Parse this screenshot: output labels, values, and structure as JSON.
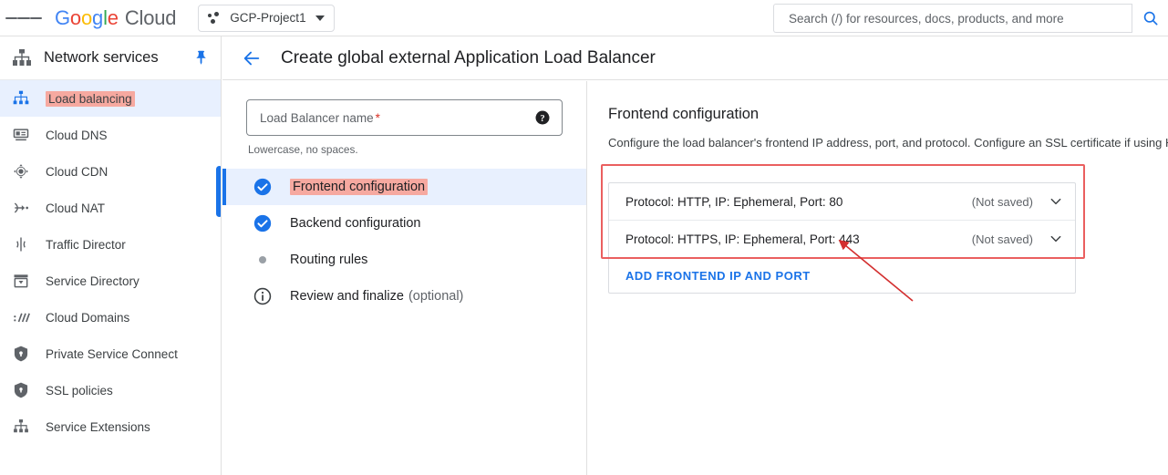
{
  "topbar": {
    "menu_icon": "hamburger-menu-icon",
    "brand": {
      "g": "G",
      "o1": "o",
      "o2": "o",
      "g2": "g",
      "l": "l",
      "e": "e",
      "cloud": "Cloud"
    },
    "project": {
      "name": "GCP-Project1",
      "icon": "project-dots-icon",
      "caret": "chevron-down-icon"
    },
    "search": {
      "placeholder": "Search (/) for resources, docs, products, and more",
      "value": "",
      "button_icon": "search-icon"
    }
  },
  "sidebar": {
    "title": "Network services",
    "header_icon": "network-services-icon",
    "pin_icon": "pin-icon",
    "items": [
      {
        "label": "Load balancing",
        "icon": "load-balancing-icon",
        "active": true,
        "highlighted": true
      },
      {
        "label": "Cloud DNS",
        "icon": "cloud-dns-icon",
        "active": false,
        "highlighted": false
      },
      {
        "label": "Cloud CDN",
        "icon": "cloud-cdn-icon",
        "active": false,
        "highlighted": false
      },
      {
        "label": "Cloud NAT",
        "icon": "cloud-nat-icon",
        "active": false,
        "highlighted": false
      },
      {
        "label": "Traffic Director",
        "icon": "traffic-director-icon",
        "active": false,
        "highlighted": false
      },
      {
        "label": "Service Directory",
        "icon": "service-directory-icon",
        "active": false,
        "highlighted": false
      },
      {
        "label": "Cloud Domains",
        "icon": "cloud-domains-icon",
        "active": false,
        "highlighted": false
      },
      {
        "label": "Private Service Connect",
        "icon": "private-service-connect-icon",
        "active": false,
        "highlighted": false
      },
      {
        "label": "SSL policies",
        "icon": "ssl-policies-icon",
        "active": false,
        "highlighted": false
      },
      {
        "label": "Service Extensions",
        "icon": "service-extensions-icon",
        "active": false,
        "highlighted": false
      }
    ]
  },
  "page": {
    "back_icon": "back-arrow-icon",
    "title": "Create global external Application Load Balancer"
  },
  "wizard": {
    "name_field": {
      "placeholder": "Load Balancer name",
      "required_marker": "*",
      "value": "",
      "help_icon": "help-icon"
    },
    "hint": "Lowercase, no spaces.",
    "steps": [
      {
        "label": "Frontend configuration",
        "status": "complete",
        "icon": "check-circle-icon",
        "active": true,
        "highlighted": true,
        "optional": ""
      },
      {
        "label": "Backend configuration",
        "status": "complete",
        "icon": "check-circle-icon",
        "active": false,
        "highlighted": false,
        "optional": ""
      },
      {
        "label": "Routing rules",
        "status": "pending",
        "icon": "dot-icon",
        "active": false,
        "highlighted": false,
        "optional": ""
      },
      {
        "label": "Review and finalize",
        "status": "info",
        "icon": "info-circle-icon",
        "active": false,
        "highlighted": false,
        "optional": "(optional)"
      }
    ]
  },
  "frontend": {
    "heading": "Frontend configuration",
    "description": "Configure the load balancer's frontend IP address, port, and protocol. Configure an SSL certificate if using H",
    "rules": [
      {
        "text": "Protocol: HTTP, IP: Ephemeral, Port: 80",
        "state": "(Not saved)",
        "chevron": "chevron-down-icon"
      },
      {
        "text": "Protocol: HTTPS, IP: Ephemeral, Port: 443",
        "state": "(Not saved)",
        "chevron": "chevron-down-icon"
      }
    ],
    "add_link": "ADD FRONTEND IP AND PORT"
  },
  "annotation": {
    "highlight_color": "#ea5f5f",
    "text_highlight_color": "#f6a9a0",
    "arrow_color": "#d32f2f",
    "arrow_target": "frontend-rule-https-row"
  }
}
